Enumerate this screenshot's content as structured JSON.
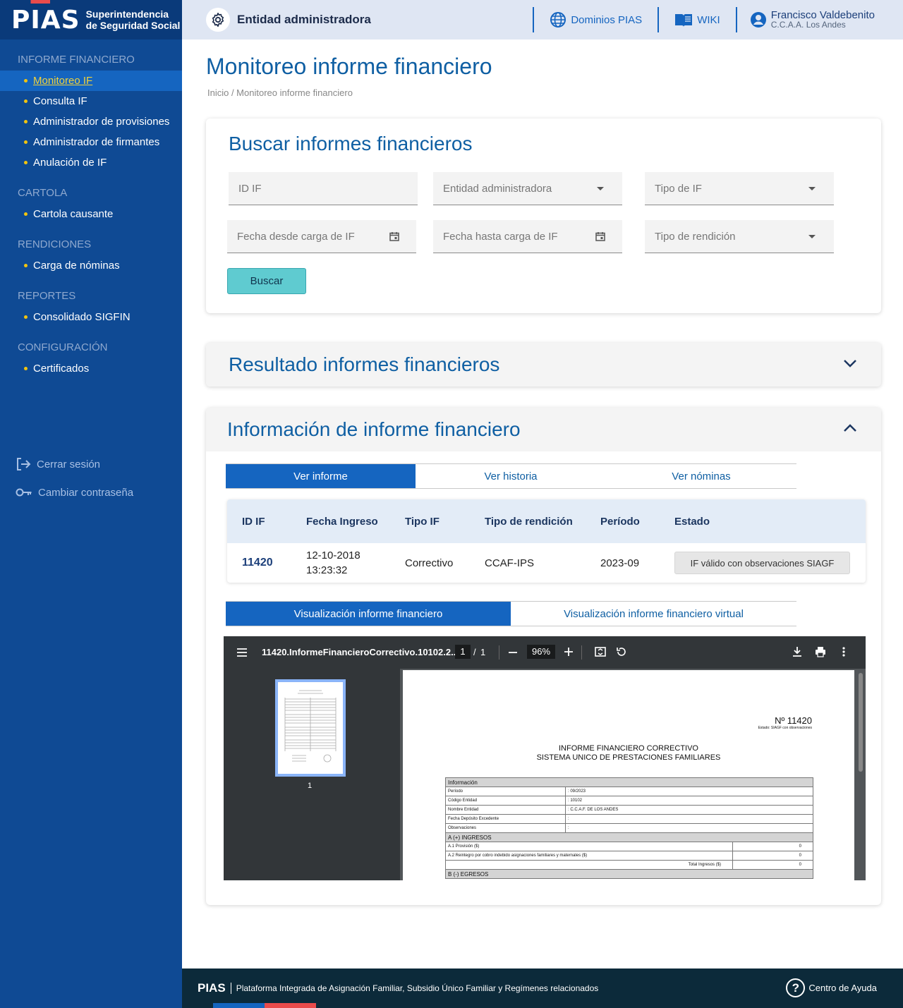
{
  "brand": {
    "logo": "PIAS",
    "subtitle_line1": "Superintendencia",
    "subtitle_line2": "de Seguridad Social"
  },
  "sidebar": {
    "sections": [
      {
        "title": "INFORME FINANCIERO",
        "items": [
          "Monitoreo IF",
          "Consulta IF",
          "Administrador de provisiones",
          "Administrador de firmantes",
          "Anulación de IF"
        ]
      },
      {
        "title": "CARTOLA",
        "items": [
          "Cartola causante"
        ]
      },
      {
        "title": "RENDICIONES",
        "items": [
          "Carga de nóminas"
        ]
      },
      {
        "title": "REPORTES",
        "items": [
          "Consolidado SIGFIN"
        ]
      },
      {
        "title": "CONFIGURACIÓN",
        "items": [
          "Certificados"
        ]
      }
    ],
    "active_item": "Monitoreo IF",
    "logout": "Cerrar sesión",
    "change_password": "Cambiar contraseña"
  },
  "header": {
    "entity": "Entidad administradora",
    "domains": "Dominios PIAS",
    "wiki": "WIKI",
    "user_name": "Francisco Valdebenito",
    "user_org": "C.C.A.A. Los Andes"
  },
  "page": {
    "title": "Monitoreo informe financiero",
    "breadcrumb": "Inicio / Monitoreo informe financiero"
  },
  "search": {
    "title": "Buscar informes financieros",
    "id_placeholder": "ID IF",
    "entity_placeholder": "Entidad administradora",
    "type_placeholder": "Tipo de IF",
    "date_from_placeholder": "Fecha desde carga de IF",
    "date_to_placeholder": "Fecha hasta carga de IF",
    "rendition_placeholder": "Tipo de rendición",
    "button": "Buscar"
  },
  "results": {
    "title": "Resultado informes financieros"
  },
  "info": {
    "title": "Información de informe financiero",
    "tabs": [
      "Ver informe",
      "Ver historia",
      "Ver nóminas"
    ],
    "table": {
      "headers": [
        "ID IF",
        "Fecha Ingreso",
        "Tipo IF",
        "Tipo de rendición",
        "Período",
        "Estado"
      ],
      "row": {
        "id": "11420",
        "date": "12-10-2018",
        "time": "13:23:32",
        "type": "Correctivo",
        "rendition": "CCAF-IPS",
        "period": "2023-09",
        "status": "IF válido con observaciones SIAGF"
      }
    },
    "view_tabs": [
      "Visualización informe financiero",
      "Visualización informe financiero virtual"
    ]
  },
  "pdf": {
    "filename": "11420.InformeFinancieroCorrectivo.10102.2...",
    "page_current": "1",
    "page_total": "1",
    "zoom": "96%",
    "thumb_label": "1",
    "doc": {
      "number": "Nº 11420",
      "estado": "Estado: SIAGF con observaciones",
      "title_line1": "INFORME FINANCIERO CORRECTIVO",
      "title_line2": "SISTEMA UNICO DE PRESTACIONES FAMILIARES",
      "section_info": "Información",
      "rows": [
        {
          "label": "Período",
          "value": ": 09/2023"
        },
        {
          "label": "Código Entidad",
          "value": ": 10102"
        },
        {
          "label": "Nombre Entidad",
          "value": ": C.C.A.F. DE LOS ANDES"
        },
        {
          "label": "Fecha Depósito Excedente",
          "value": ":"
        },
        {
          "label": "Observaciones",
          "value": ":"
        }
      ],
      "section_ingresos": "A (+) INGRESOS",
      "ingresos": [
        {
          "label": "A.1 Provisión ($)",
          "value": "0"
        },
        {
          "label": "A.2 Reintegro por cobro indebido asignaciones familiares y maternales ($)",
          "value": "0"
        }
      ],
      "total_label": "Total Ingresos ($)",
      "total_value": "0",
      "section_egresos": "B (-) EGRESOS"
    }
  },
  "footer": {
    "logo": "PIAS",
    "text": "Plataforma Integrada de Asignación Familiar, Subsidio Único Familiar y Regímenes relacionados",
    "help": "Centro de Ayuda"
  },
  "colors": {
    "sidebar_bg": "#0f4a94",
    "accent": "#1565c0",
    "title_blue": "#0f5fa3",
    "button": "#5fcbd0"
  }
}
